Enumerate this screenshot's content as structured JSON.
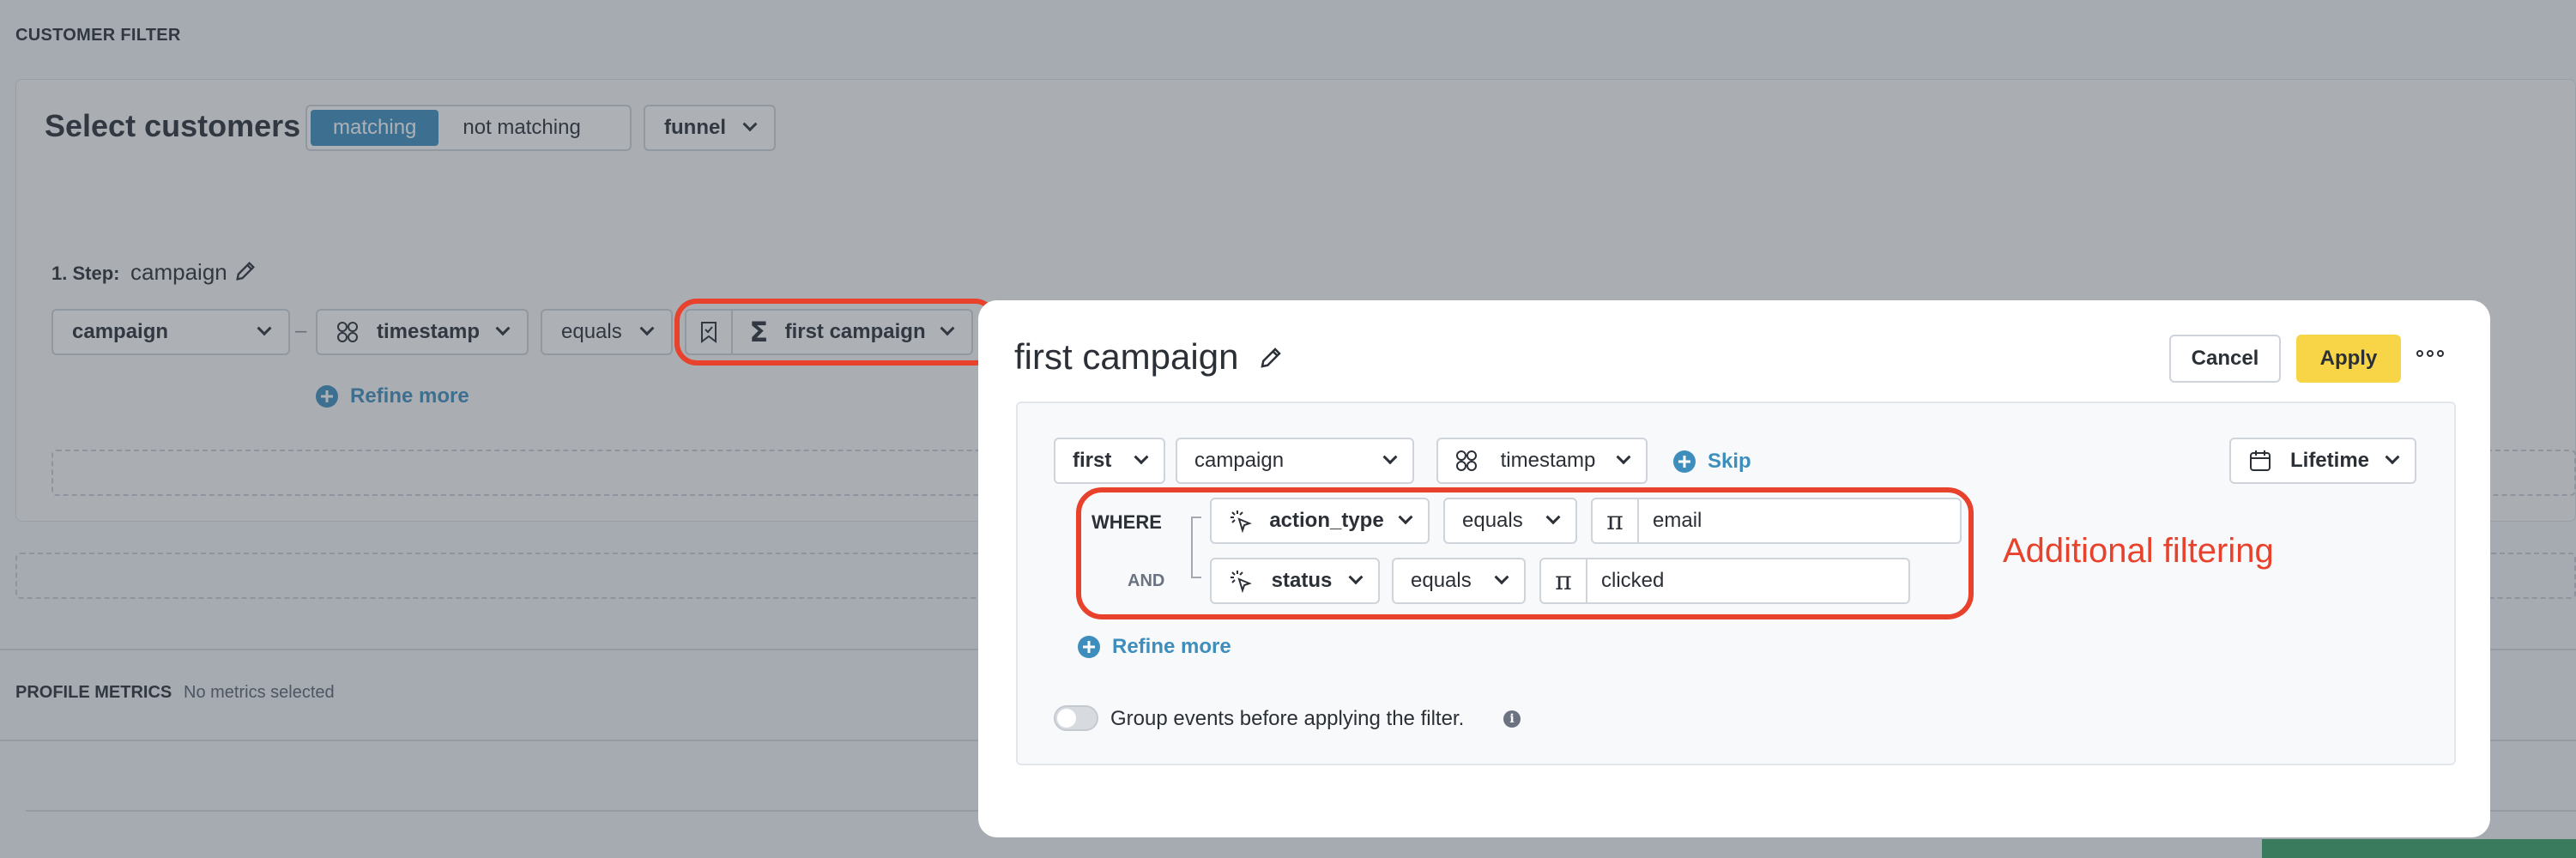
{
  "customer_filter": {
    "section_title": "CUSTOMER FILTER",
    "title": "Select customers",
    "segment": {
      "options": [
        "matching",
        "not matching"
      ],
      "selected": "matching"
    },
    "mode_dropdown": "funnel",
    "step": {
      "label": "1. Step:",
      "name": "campaign"
    },
    "row": {
      "event_dropdown": "campaign",
      "dash": "–",
      "attribute_dropdown": "timestamp",
      "operator_dropdown": "equals",
      "aggregate_dropdown": "first campaign"
    },
    "refine_more": "Refine more"
  },
  "profile_metrics": {
    "title": "PROFILE METRICS",
    "note": "No metrics selected"
  },
  "modal": {
    "title": "first campaign",
    "cancel_label": "Cancel",
    "apply_label": "Apply",
    "row": {
      "first_dropdown": "first",
      "event_dropdown": "campaign",
      "attribute_dropdown": "timestamp",
      "skip_label": "Skip",
      "lifetime_dropdown": "Lifetime"
    },
    "where_label": "WHERE",
    "and_label": "AND",
    "conditions": [
      {
        "property": "action_type",
        "operator": "equals",
        "value": "email"
      },
      {
        "property": "status",
        "operator": "equals",
        "value": "clicked"
      }
    ],
    "refine_more": "Refine more",
    "group_events_label": "Group events before applying the filter.",
    "group_events_enabled": false
  },
  "annotation": {
    "text": "Additional filtering",
    "color": "#e8412c"
  },
  "colors": {
    "accent": "#3d8ebd",
    "apply": "#f7d547",
    "annotation": "#e8412c"
  },
  "icons": [
    "pencil-icon",
    "chevron-down-icon",
    "grid-icon",
    "bookmark-icon",
    "sigma-icon",
    "plus-circle-icon",
    "calendar-icon",
    "cursor-click-icon",
    "text-type-icon",
    "more-icon",
    "info-icon"
  ]
}
